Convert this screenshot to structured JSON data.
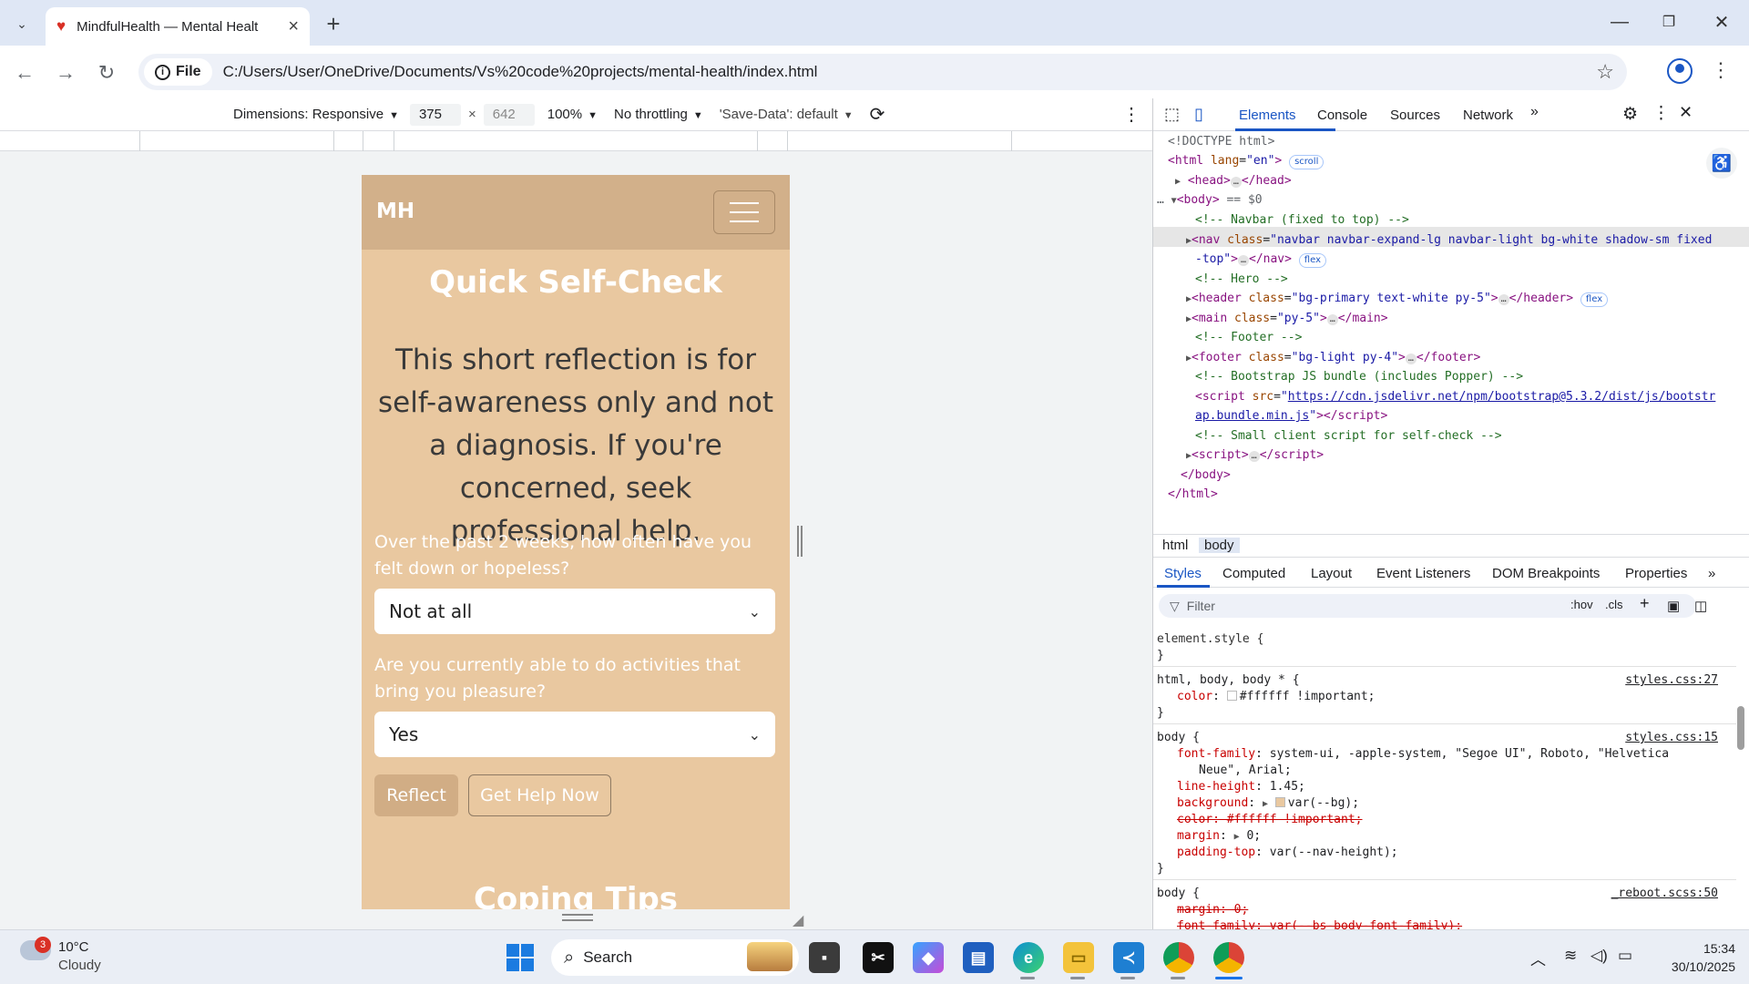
{
  "browser": {
    "tab_title": "MindfulHealth — Mental Healt",
    "address_chip": "File",
    "url": "C:/Users/User/OneDrive/Documents/Vs%20code%20projects/mental-health/index.html"
  },
  "device_toolbar": {
    "dimensions": "Dimensions: Responsive",
    "width": "375",
    "height": "642",
    "zoom": "100%",
    "throttling": "No throttling",
    "save_data": "'Save-Data': default"
  },
  "page": {
    "brand": "MH",
    "title": "Quick Self-Check",
    "lead": "This short reflection is for self-awareness only and not a diagnosis. If you're concerned, seek professional help.",
    "q1": "Over the past 2 weeks, how often have you felt down or hopeless?",
    "q1_value": "Not at all",
    "q2": "Are you currently able to do activities that bring you pleasure?",
    "q2_value": "Yes",
    "reflect_btn": "Reflect",
    "help_btn": "Get Help Now",
    "next_title": "Coping Tips"
  },
  "devtools": {
    "tabs": [
      "Elements",
      "Console",
      "Sources",
      "Network"
    ],
    "breadcrumbs": [
      "html",
      "body"
    ],
    "sub_tabs": [
      "Styles",
      "Computed",
      "Layout",
      "Event Listeners",
      "DOM Breakpoints",
      "Properties"
    ],
    "filter_placeholder": "Filter",
    "hov": ":hov",
    "cls": ".cls",
    "dom": {
      "doctype": "<!DOCTYPE html>",
      "html_open": "<html",
      "html_lang_attr": "lang",
      "html_lang_val": "\"en\"",
      "scroll_badge": "scroll",
      "head": "<head>",
      "head_close": "</head>",
      "body_open": "<body>",
      "body_eq": "== $0",
      "c_navbar": "<!-- Navbar (fixed to top) -->",
      "nav_class": "\"navbar navbar-expand-lg navbar-light bg-white shadow-sm fixed",
      "nav_class2": "-top\"",
      "flex": "flex",
      "c_hero": "<!-- Hero -->",
      "header_class": "\"bg-primary text-white py-5\"",
      "main_class": "\"py-5\"",
      "c_footer": "<!-- Footer -->",
      "footer_class": "\"bg-light py-4\"",
      "c_bootstrap": "<!-- Bootstrap JS bundle (includes Popper) -->",
      "script_src1": "https://cdn.jsdelivr.net/npm/bootstrap@5.3.2/dist/js/bootstr",
      "script_src2": "ap.bundle.min.js",
      "c_client": "<!-- Small client script for self-check -->",
      "body_close": "</body>",
      "html_close": "</html>"
    },
    "styles": {
      "element_style": "element.style {",
      "rule1_sel": "html, body, body * {",
      "rule1_src": "styles.css:27",
      "rule1_prop": "color",
      "rule1_val": "#ffffff !important;",
      "rule2_sel": "body {",
      "rule2_src": "styles.css:15",
      "ff_prop": "font-family",
      "ff_val": "system-ui, -apple-system, \"Segoe UI\", Roboto, \"Helvetica",
      "ff_val2": "Neue\", Arial;",
      "lh_prop": "line-height",
      "lh_val": "1.45;",
      "bg_prop": "background",
      "bg_val": "var(--bg);",
      "color_strike": "color: #ffffff !important;",
      "margin_prop": "margin",
      "margin_val": "0;",
      "pt_prop": "padding-top",
      "pt_val": "var(--nav-height);",
      "rule3_sel": "body {",
      "rule3_src": "_reboot.scss:50",
      "rule3_l1": "margin: 0;",
      "rule3_l2": "font-family: var(--bs-body-font-family);"
    }
  },
  "taskbar": {
    "weather_badge": "3",
    "temp": "10°C",
    "condition": "Cloudy",
    "search": "Search",
    "time": "15:34",
    "date": "30/10/2025"
  },
  "colors": {
    "page_bg": "#e9c8a0",
    "nav_bg": "#d2b08a",
    "accent_blue": "#1a56c4"
  }
}
